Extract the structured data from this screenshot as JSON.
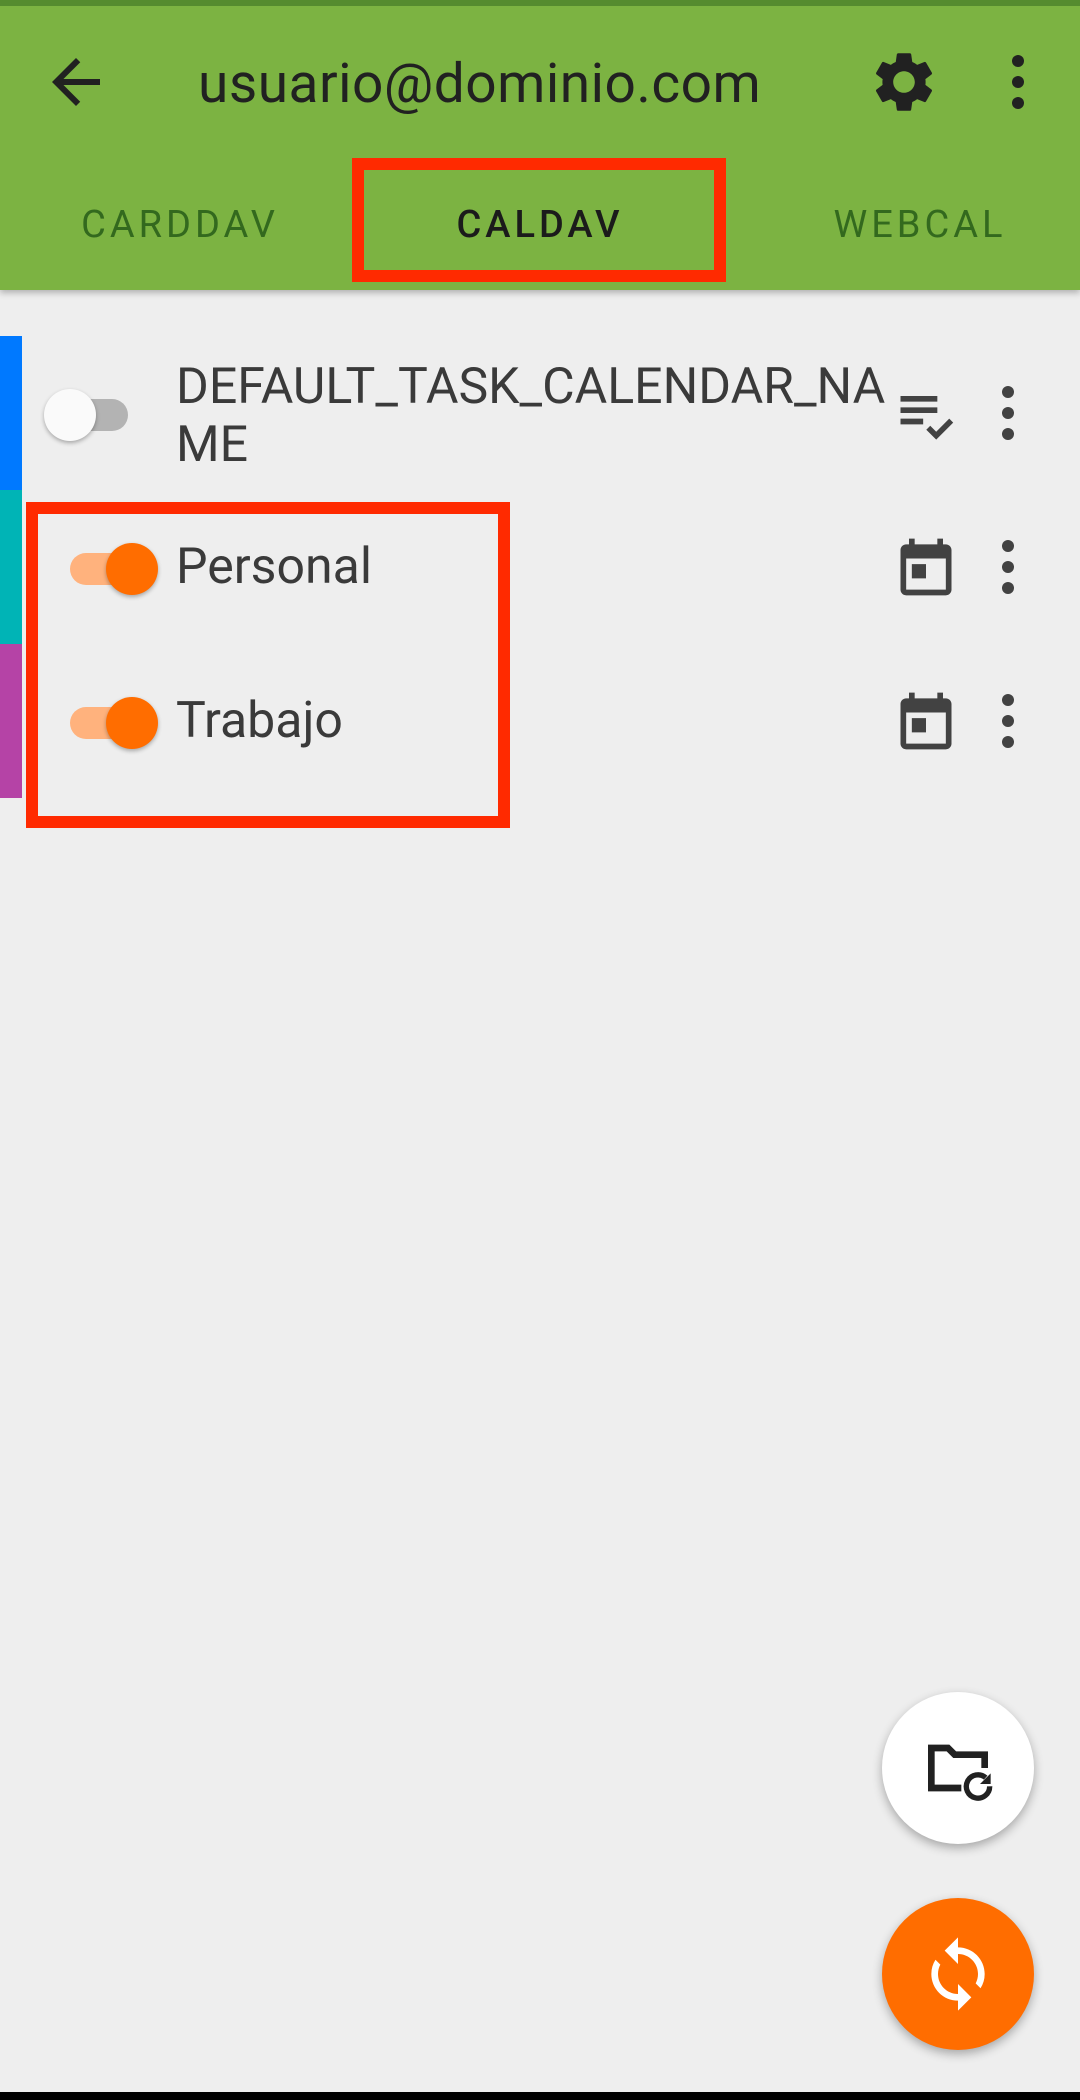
{
  "header": {
    "title": "usuario@dominio.com",
    "back_icon": "arrow-back-icon",
    "settings_icon": "gear-icon",
    "overflow_icon": "more-vert-icon"
  },
  "tabs": [
    {
      "label": "CARDDAV",
      "selected": false
    },
    {
      "label": "CALDAV",
      "selected": true
    },
    {
      "label": "WEBCAL",
      "selected": false
    }
  ],
  "collections": [
    {
      "name": "DEFAULT_TASK_CALENDAR_NAME",
      "name_line1": "DEFAULT_TASK_CALENDAR_NA",
      "name_line2": "ME",
      "enabled": false,
      "color": "#0079ff",
      "type_icon": "task-list-icon"
    },
    {
      "name": "Personal",
      "enabled": true,
      "color": "#00b4b6",
      "type_icon": "calendar-icon"
    },
    {
      "name": "Trabajo",
      "enabled": true,
      "color": "#b543a6",
      "type_icon": "calendar-icon"
    }
  ],
  "fabs": {
    "refresh_collections_icon": "folder-refresh-icon",
    "sync_icon": "sync-icon"
  },
  "colors": {
    "toolbar": "#7cb342",
    "accent": "#ff6d00",
    "highlight": "#ff2a00"
  }
}
